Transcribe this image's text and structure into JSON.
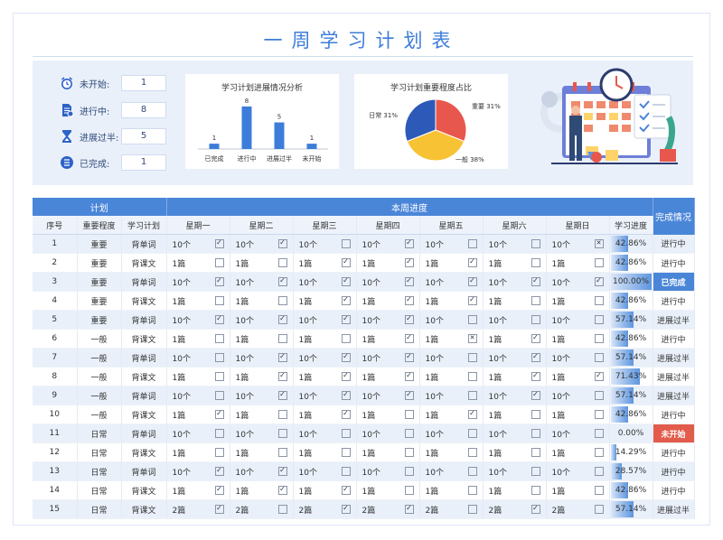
{
  "title": "一周学习计划表",
  "stats": [
    {
      "label": "未开始:",
      "value": "1",
      "icon": "clock-icon"
    },
    {
      "label": "进行中:",
      "value": "8",
      "icon": "document-icon"
    },
    {
      "label": "进展过半:",
      "value": "5",
      "icon": "hourglass-icon"
    },
    {
      "label": "已完成:",
      "value": "1",
      "icon": "list-icon"
    }
  ],
  "bar_card": {
    "title": "学习计划进展情况分析"
  },
  "pie_card": {
    "title": "学习计划重要程度占比"
  },
  "chart_data": [
    {
      "type": "bar",
      "title": "学习计划进展情况分析",
      "categories": [
        "已完成",
        "进行中",
        "进展过半",
        "未开始"
      ],
      "values": [
        1,
        8,
        5,
        1
      ],
      "ylim": [
        0,
        9
      ],
      "grid": false,
      "color": "#3c7dd9"
    },
    {
      "type": "pie",
      "title": "学习计划重要程度占比",
      "labels": [
        "重要",
        "一般",
        "日常"
      ],
      "values": [
        31,
        38,
        31
      ],
      "value_labels": [
        "重要 31%",
        "一般 38%",
        "日常 31%"
      ],
      "colors": [
        "#e8574d",
        "#f7c233",
        "#2d59b8"
      ]
    }
  ],
  "table": {
    "group_plan": "计划",
    "group_week": "本周进度",
    "col_status": "完成情况",
    "col_no": "序号",
    "col_importance": "重要程度",
    "col_plan": "学习计划",
    "days": [
      "星期一",
      "星期二",
      "星期三",
      "星期四",
      "星期五",
      "星期六",
      "星期日"
    ],
    "col_progress": "学习进度",
    "rows": [
      {
        "no": "1",
        "imp": "重要",
        "plan": "背单词",
        "cells": [
          [
            "10个",
            "on"
          ],
          [
            "10个",
            "on"
          ],
          [
            "10个",
            ""
          ],
          [
            "10个",
            "on"
          ],
          [
            "10个",
            ""
          ],
          [
            "10个",
            ""
          ],
          [
            "10个",
            "x"
          ]
        ],
        "progress": "42.86%",
        "pct": 0.4286,
        "status": "进行中",
        "st": ""
      },
      {
        "no": "2",
        "imp": "重要",
        "plan": "背课文",
        "cells": [
          [
            "1篇",
            ""
          ],
          [
            "1篇",
            ""
          ],
          [
            "1篇",
            "on"
          ],
          [
            "1篇",
            "on"
          ],
          [
            "1篇",
            "on"
          ],
          [
            "1篇",
            ""
          ],
          [
            "1篇",
            ""
          ]
        ],
        "progress": "42.86%",
        "pct": 0.4286,
        "status": "进行中",
        "st": ""
      },
      {
        "no": "3",
        "imp": "重要",
        "plan": "背单词",
        "cells": [
          [
            "10个",
            "on"
          ],
          [
            "10个",
            "on"
          ],
          [
            "10个",
            "on"
          ],
          [
            "10个",
            "on"
          ],
          [
            "10个",
            "on"
          ],
          [
            "10个",
            "on"
          ],
          [
            "10个",
            "on"
          ]
        ],
        "progress": "100.00%",
        "pct": 1.0,
        "status": "已完成",
        "st": "done"
      },
      {
        "no": "4",
        "imp": "重要",
        "plan": "背课文",
        "cells": [
          [
            "1篇",
            ""
          ],
          [
            "1篇",
            ""
          ],
          [
            "1篇",
            "on"
          ],
          [
            "1篇",
            "on"
          ],
          [
            "1篇",
            "on"
          ],
          [
            "1篇",
            ""
          ],
          [
            "1篇",
            ""
          ]
        ],
        "progress": "42.86%",
        "pct": 0.4286,
        "status": "进行中",
        "st": ""
      },
      {
        "no": "5",
        "imp": "重要",
        "plan": "背单词",
        "cells": [
          [
            "10个",
            "on"
          ],
          [
            "10个",
            "on"
          ],
          [
            "10个",
            "on"
          ],
          [
            "10个",
            "on"
          ],
          [
            "10个",
            ""
          ],
          [
            "10个",
            ""
          ],
          [
            "10个",
            ""
          ]
        ],
        "progress": "57.14%",
        "pct": 0.5714,
        "status": "进展过半",
        "st": ""
      },
      {
        "no": "6",
        "imp": "一般",
        "plan": "背课文",
        "cells": [
          [
            "1篇",
            ""
          ],
          [
            "1篇",
            ""
          ],
          [
            "1篇",
            ""
          ],
          [
            "1篇",
            "on"
          ],
          [
            "1篇",
            "x"
          ],
          [
            "1篇",
            "on"
          ],
          [
            "1篇",
            ""
          ]
        ],
        "progress": "42.86%",
        "pct": 0.4286,
        "status": "进行中",
        "st": ""
      },
      {
        "no": "7",
        "imp": "一般",
        "plan": "背单词",
        "cells": [
          [
            "10个",
            ""
          ],
          [
            "10个",
            "on"
          ],
          [
            "10个",
            "on"
          ],
          [
            "10个",
            "on"
          ],
          [
            "10个",
            ""
          ],
          [
            "10个",
            "on"
          ],
          [
            "10个",
            ""
          ]
        ],
        "progress": "57.14%",
        "pct": 0.5714,
        "status": "进展过半",
        "st": ""
      },
      {
        "no": "8",
        "imp": "一般",
        "plan": "背课文",
        "cells": [
          [
            "1篇",
            ""
          ],
          [
            "1篇",
            "on"
          ],
          [
            "1篇",
            "on"
          ],
          [
            "1篇",
            "on"
          ],
          [
            "1篇",
            ""
          ],
          [
            "1篇",
            "on"
          ],
          [
            "1篇",
            "on"
          ]
        ],
        "progress": "71.43%",
        "pct": 0.7143,
        "status": "进展过半",
        "st": ""
      },
      {
        "no": "9",
        "imp": "一般",
        "plan": "背单词",
        "cells": [
          [
            "10个",
            ""
          ],
          [
            "10个",
            "on"
          ],
          [
            "10个",
            "on"
          ],
          [
            "10个",
            "on"
          ],
          [
            "10个",
            ""
          ],
          [
            "10个",
            "on"
          ],
          [
            "10个",
            ""
          ]
        ],
        "progress": "57.14%",
        "pct": 0.5714,
        "status": "进展过半",
        "st": ""
      },
      {
        "no": "10",
        "imp": "一般",
        "plan": "背课文",
        "cells": [
          [
            "1篇",
            "on"
          ],
          [
            "1篇",
            ""
          ],
          [
            "1篇",
            "on"
          ],
          [
            "1篇",
            ""
          ],
          [
            "1篇",
            "on"
          ],
          [
            "1篇",
            ""
          ],
          [
            "1篇",
            ""
          ]
        ],
        "progress": "42.86%",
        "pct": 0.4286,
        "status": "进行中",
        "st": ""
      },
      {
        "no": "11",
        "imp": "日常",
        "plan": "背单词",
        "cells": [
          [
            "10个",
            ""
          ],
          [
            "10个",
            ""
          ],
          [
            "10个",
            ""
          ],
          [
            "10个",
            ""
          ],
          [
            "10个",
            ""
          ],
          [
            "10个",
            ""
          ],
          [
            "10个",
            ""
          ]
        ],
        "progress": "0.00%",
        "pct": 0.0,
        "status": "未开始",
        "st": "ns"
      },
      {
        "no": "12",
        "imp": "日常",
        "plan": "背课文",
        "cells": [
          [
            "1篇",
            ""
          ],
          [
            "1篇",
            ""
          ],
          [
            "1篇",
            ""
          ],
          [
            "1篇",
            ""
          ],
          [
            "1篇",
            ""
          ],
          [
            "1篇",
            ""
          ],
          [
            "1篇",
            ""
          ]
        ],
        "progress": "14.29%",
        "pct": 0.1429,
        "status": "进行中",
        "st": ""
      },
      {
        "no": "13",
        "imp": "日常",
        "plan": "背单词",
        "cells": [
          [
            "10个",
            "on"
          ],
          [
            "10个",
            "on"
          ],
          [
            "10个",
            ""
          ],
          [
            "10个",
            ""
          ],
          [
            "10个",
            ""
          ],
          [
            "10个",
            ""
          ],
          [
            "10个",
            ""
          ]
        ],
        "progress": "28.57%",
        "pct": 0.2857,
        "status": "进行中",
        "st": ""
      },
      {
        "no": "14",
        "imp": "日常",
        "plan": "背课文",
        "cells": [
          [
            "1篇",
            "on"
          ],
          [
            "1篇",
            "on"
          ],
          [
            "1篇",
            "on"
          ],
          [
            "1篇",
            ""
          ],
          [
            "1篇",
            ""
          ],
          [
            "1篇",
            ""
          ],
          [
            "1篇",
            ""
          ]
        ],
        "progress": "42.86%",
        "pct": 0.4286,
        "status": "进行中",
        "st": ""
      },
      {
        "no": "15",
        "imp": "日常",
        "plan": "背课文",
        "cells": [
          [
            "2篇",
            "on"
          ],
          [
            "2篇",
            ""
          ],
          [
            "2篇",
            "on"
          ],
          [
            "2篇",
            "on"
          ],
          [
            "2篇",
            ""
          ],
          [
            "2篇",
            "on"
          ],
          [
            "2篇",
            ""
          ]
        ],
        "progress": "57.14%",
        "pct": 0.5714,
        "status": "进展过半",
        "st": ""
      }
    ]
  }
}
